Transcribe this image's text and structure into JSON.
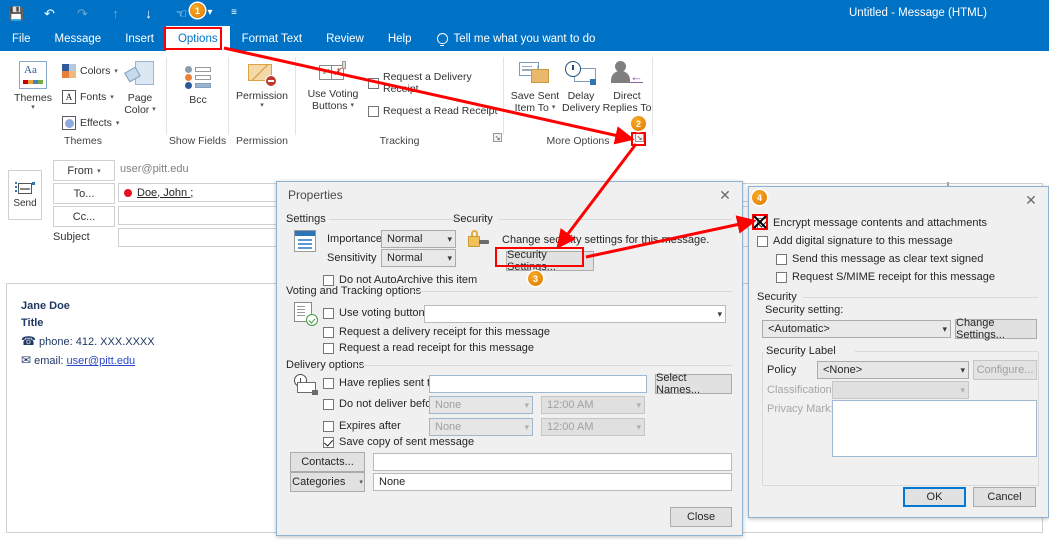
{
  "window": {
    "title": "Untitled  -  Message (HTML)",
    "quick_access": [
      "save-icon",
      "undo-icon",
      "redo-icon",
      "up-icon",
      "down-icon",
      "touch-mode-icon",
      "customize-qat-icon"
    ]
  },
  "ribbon": {
    "tabs": [
      {
        "label": "File",
        "active": false
      },
      {
        "label": "Message",
        "active": false
      },
      {
        "label": "Insert",
        "active": false
      },
      {
        "label": "Options",
        "active": true
      },
      {
        "label": "Format Text",
        "active": false
      },
      {
        "label": "Review",
        "active": false
      },
      {
        "label": "Help",
        "active": false
      }
    ],
    "tell_me": "Tell me what you want to do",
    "groups": [
      {
        "name": "Themes",
        "label": "Themes",
        "items": [
          {
            "label": "Themes",
            "has_caret": true
          },
          {
            "label": "Colors",
            "has_caret": true
          },
          {
            "label": "Fonts",
            "has_caret": true
          },
          {
            "label": "Effects",
            "has_caret": true
          },
          {
            "label": "Page Color",
            "line1": "Page",
            "line2": "Color",
            "has_caret": true
          }
        ]
      },
      {
        "name": "Show Fields",
        "label": "Show Fields",
        "items": [
          {
            "label": "Bcc",
            "has_caret": false
          }
        ]
      },
      {
        "name": "Permission",
        "label": "Permission",
        "items": [
          {
            "label": "Permission",
            "has_caret": true
          }
        ]
      },
      {
        "name": "Tracking",
        "label": "Tracking",
        "items": [
          {
            "label": "Use Voting Buttons",
            "line1": "Use Voting",
            "line2": "Buttons",
            "has_caret": true
          },
          {
            "label": "Request a Delivery Receipt",
            "checked": false
          },
          {
            "label": "Request a Read Receipt",
            "checked": false
          }
        ]
      },
      {
        "name": "More Options",
        "label": "More Options",
        "items": [
          {
            "label": "Save Sent Item To",
            "line1": "Save Sent",
            "line2": "Item To",
            "has_caret": true
          },
          {
            "label": "Delay Delivery",
            "line1": "Delay",
            "line2": "Delivery",
            "has_caret": false
          },
          {
            "label": "Direct Replies To",
            "line1": "Direct",
            "line2": "Replies To",
            "has_caret": false
          }
        ]
      }
    ]
  },
  "compose": {
    "send_label": "Send",
    "from_label": "From",
    "from_value": "user@pitt.edu",
    "to_label": "To...",
    "to_value": "Doe, John ;",
    "cc_label": "Cc...",
    "cc_value": "",
    "subject_label": "Subject",
    "subject_value": "",
    "signature": {
      "name": "Jane Doe",
      "title": "Title",
      "phone": "phone: 412. XXX.XXXX",
      "email_label": "email:",
      "email": "user@pitt.edu"
    }
  },
  "properties_dialog": {
    "title": "Properties",
    "close_label": "✕",
    "settings": {
      "legend": "Settings",
      "importance_label": "Importance",
      "importance_value": "Normal",
      "sensitivity_label": "Sensitivity",
      "sensitivity_value": "Normal",
      "no_autoarchive_label": "Do not AutoArchive this item",
      "no_autoarchive_checked": false
    },
    "security": {
      "legend": "Security",
      "description": "Change security settings for this message.",
      "settings_button": "Security Settings..."
    },
    "voting": {
      "legend": "Voting and Tracking options",
      "use_voting_label": "Use voting buttons",
      "use_voting_checked": false,
      "use_voting_value": "",
      "delivery_receipt_label": "Request a delivery receipt for this message",
      "delivery_receipt_checked": false,
      "read_receipt_label": "Request a read receipt for this message",
      "read_receipt_checked": false
    },
    "delivery": {
      "legend": "Delivery options",
      "have_replies_label": "Have replies sent to",
      "have_replies_checked": false,
      "have_replies_value": "",
      "select_names_button": "Select Names...",
      "not_before_label": "Do not deliver before",
      "not_before_checked": false,
      "not_before_date": "None",
      "not_before_time": "12:00 AM",
      "expires_label": "Expires after",
      "expires_checked": false,
      "expires_date": "None",
      "expires_time": "12:00 AM",
      "save_copy_label": "Save copy of sent message",
      "save_copy_checked": true,
      "contacts_button": "Contacts...",
      "contacts_value": "",
      "categories_button": "Categories",
      "categories_value": "None"
    },
    "close_button": "Close"
  },
  "security_dialog": {
    "title": "",
    "close_label": "✕",
    "encrypt_label": "Encrypt message contents and attachments",
    "encrypt_checked": true,
    "digital_signature_label": "Add digital signature to this message",
    "digital_signature_checked": false,
    "clear_text_label": "Send this message as clear text signed",
    "clear_text_checked": false,
    "smime_label": "Request S/MIME receipt for this message",
    "smime_checked": false,
    "security_legend": "Security",
    "security_setting_label": "Security setting:",
    "security_setting_value": "<Automatic>",
    "change_settings_button": "Change Settings...",
    "security_label_legend": "Security Label",
    "policy_label": "Policy",
    "policy_value": "<None>",
    "configure_button": "Configure...",
    "classification_label": "Classification",
    "classification_value": "",
    "privacy_mark_label": "Privacy Mark:",
    "privacy_mark_value": "",
    "ok_button": "OK",
    "cancel_button": "Cancel"
  },
  "annotations": {
    "accent_color": "#ff0000",
    "badge_color": "#e07b00",
    "steps": [
      {
        "number": "1",
        "target": "options-tab"
      },
      {
        "number": "2",
        "target": "more-options-dialog-launcher"
      },
      {
        "number": "3",
        "target": "security-settings-button"
      },
      {
        "number": "4",
        "target": "encrypt-checkbox"
      }
    ]
  }
}
